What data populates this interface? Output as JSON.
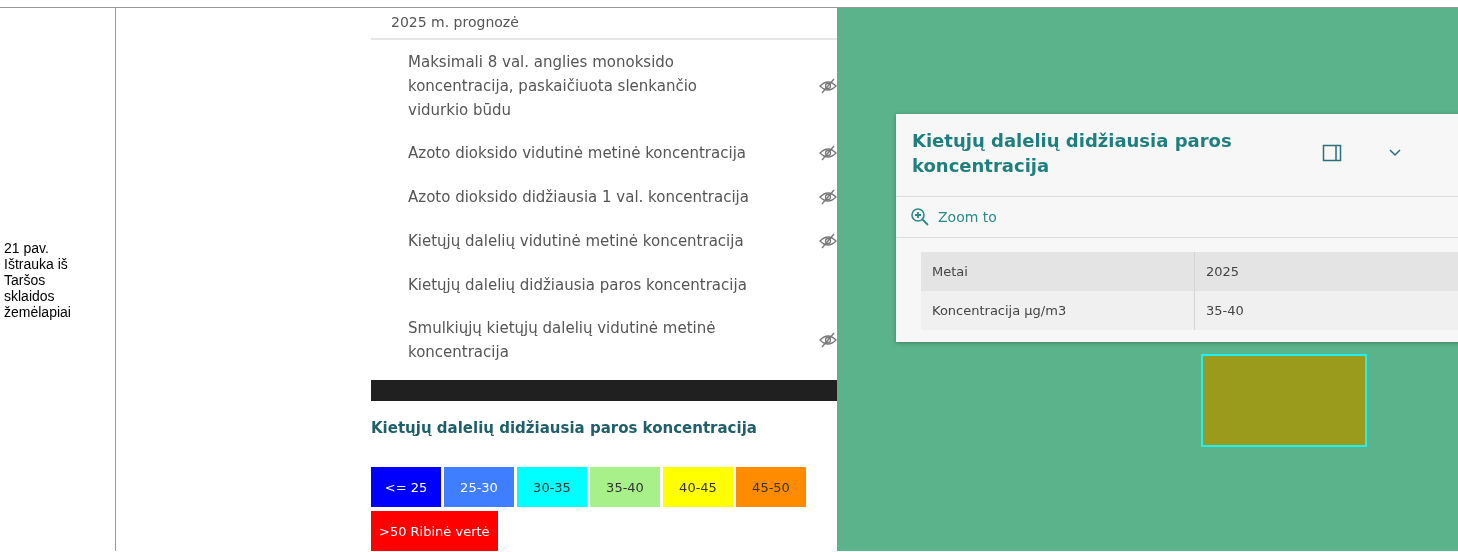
{
  "caption": {
    "lines": [
      "21 pav.",
      "Ištrauka iš",
      "Taršos",
      "sklaidos",
      "žemėlapiai"
    ]
  },
  "layer_panel": {
    "group_title": "2025 m. prognozė",
    "layers": [
      {
        "label": "Maksimali 8 val. anglies monoksido koncentracija, paskaičiuota slenkančio vidurkio būdu",
        "visible": false
      },
      {
        "label": "Azoto dioksido vidutinė metinė koncentracija",
        "visible": false
      },
      {
        "label": "Azoto dioksido didžiausia 1 val. koncentracija",
        "visible": false
      },
      {
        "label": "Kietųjų dalelių vidutinė metinė koncentracija",
        "visible": false
      },
      {
        "label": "Kietųjų dalelių didžiausia paros koncentracija",
        "visible": true
      },
      {
        "label": "Smulkiųjų kietųjų dalelių vidutinė metinė koncentracija",
        "visible": false
      }
    ]
  },
  "legend": {
    "title": "Kietųjų dalelių didžiausia paros koncentracija",
    "items": [
      {
        "label": "<= 25",
        "color": "#0000ff"
      },
      {
        "label": "25-30",
        "color": "#3f7fff"
      },
      {
        "label": "30-35",
        "color": "#00ffff"
      },
      {
        "label": "35-40",
        "color": "#a8f08a"
      },
      {
        "label": "40-45",
        "color": "#ffff00"
      },
      {
        "label": "45-50",
        "color": "#ff8c00"
      },
      {
        "label": ">50 Ribinė vertė",
        "color": "#ff0000"
      }
    ]
  },
  "popup": {
    "title": "Kietųjų dalelių didžiausia paros koncentracija",
    "action": "Zoom to",
    "rows": [
      {
        "field": "Metai",
        "value": "2025"
      },
      {
        "field": "Koncentracija µg/m3",
        "value": "35-40"
      }
    ]
  }
}
